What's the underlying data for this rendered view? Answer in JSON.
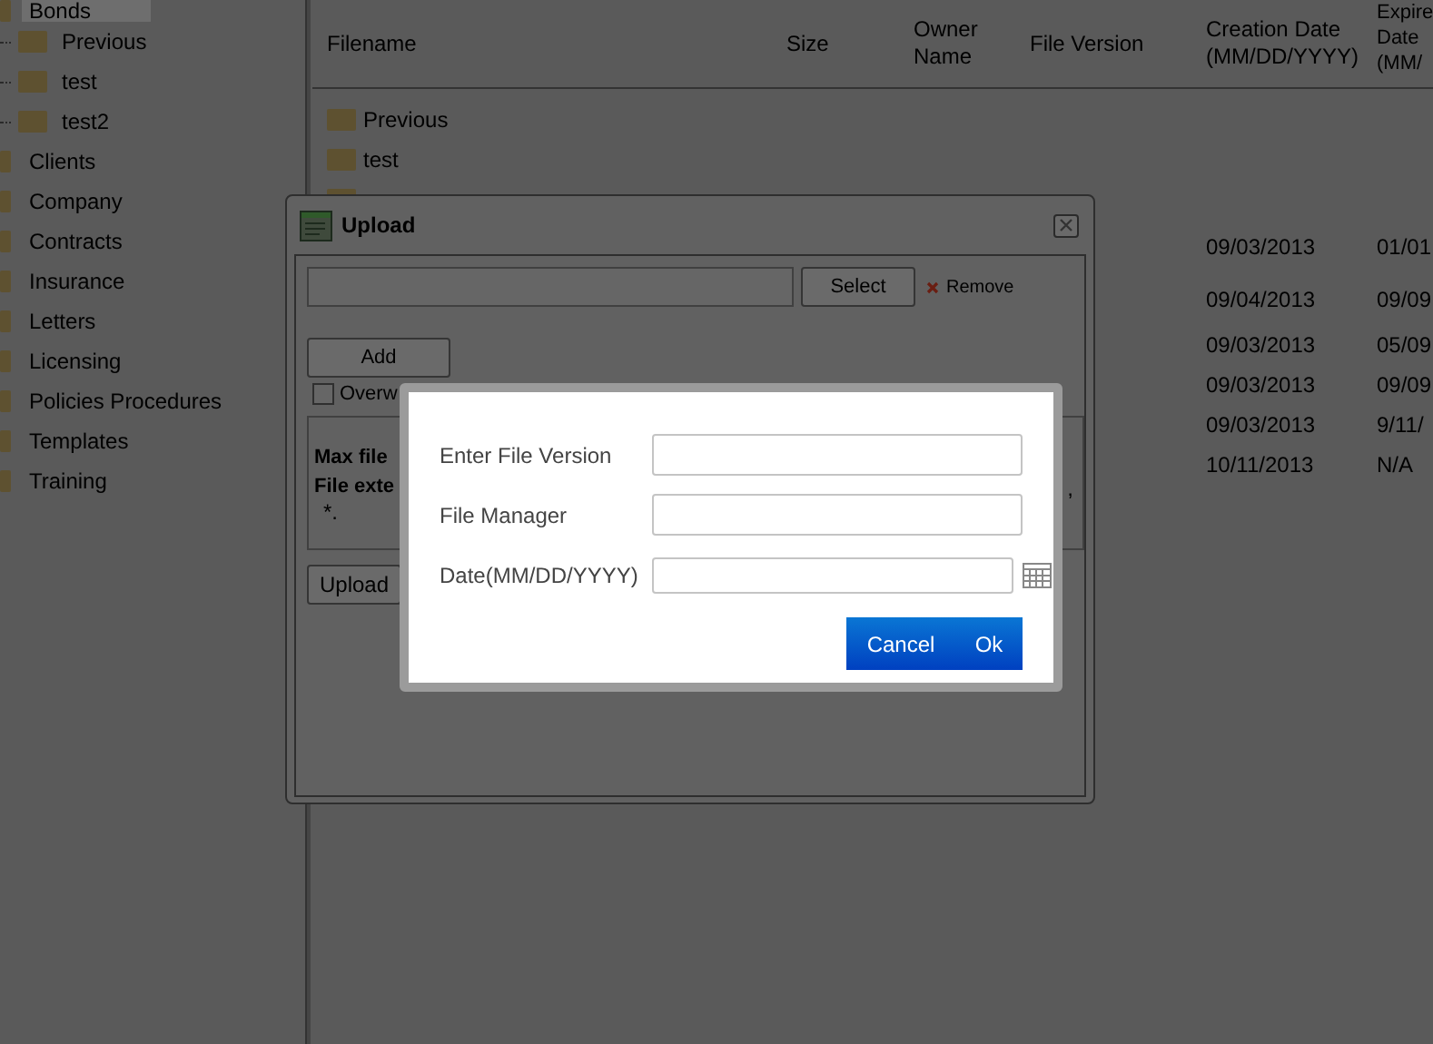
{
  "sidebar": {
    "items": [
      {
        "label": "Bonds",
        "selected": true,
        "children": [
          {
            "label": "Previous"
          },
          {
            "label": "test"
          },
          {
            "label": "test2"
          }
        ]
      },
      {
        "label": "Clients",
        "selected": false
      },
      {
        "label": "Company",
        "selected": false
      },
      {
        "label": "Contracts",
        "selected": false
      },
      {
        "label": "Insurance",
        "selected": false
      },
      {
        "label": "Letters",
        "selected": false
      },
      {
        "label": "Licensing",
        "selected": false
      },
      {
        "label": "Policies Procedures",
        "selected": false
      },
      {
        "label": "Templates",
        "selected": false
      },
      {
        "label": "Training",
        "selected": false
      }
    ]
  },
  "table": {
    "columns": [
      "Filename",
      "Size",
      "Owner Name",
      "File Version",
      "Creation Date (MM/DD/YYYY)",
      "Expire Date (MM/"
    ],
    "rows": [
      {
        "kind": "folder",
        "filename": "Previous"
      },
      {
        "kind": "folder",
        "filename": "test"
      },
      {
        "kind": "folder"
      },
      {
        "kind": "file",
        "creation_date": "09/03/2013",
        "expire_date": "01/01"
      },
      {
        "kind": "file",
        "creation_date": "09/04/2013",
        "expire_date": "09/09"
      },
      {
        "kind": "file",
        "creation_date": "09/03/2013",
        "expire_date": "05/09"
      },
      {
        "kind": "file",
        "creation_date": "09/03/2013",
        "expire_date": "09/09"
      },
      {
        "kind": "file",
        "creation_date": "09/03/2013",
        "expire_date": "9/11/"
      },
      {
        "kind": "file",
        "creation_date": "10/11/2013",
        "expire_date": "N/A"
      }
    ]
  },
  "upload_dialog": {
    "title": "Upload",
    "select_button": "Select",
    "remove_link": "Remove",
    "add_button": "Add",
    "overwrite": {
      "label": "Overw",
      "checked": false
    },
    "info": {
      "line_1": "Max file",
      "line_2": "File exte",
      "line_3": "*.",
      "fragment": ","
    },
    "upload_button": "Upload"
  },
  "modal": {
    "fields": [
      {
        "label": "Enter File Version",
        "kind": "text"
      },
      {
        "label": "File Manager",
        "kind": "text"
      },
      {
        "label": "Date(MM/DD/YYYY)",
        "kind": "date"
      }
    ],
    "buttons": [
      "Cancel",
      "Ok"
    ]
  }
}
